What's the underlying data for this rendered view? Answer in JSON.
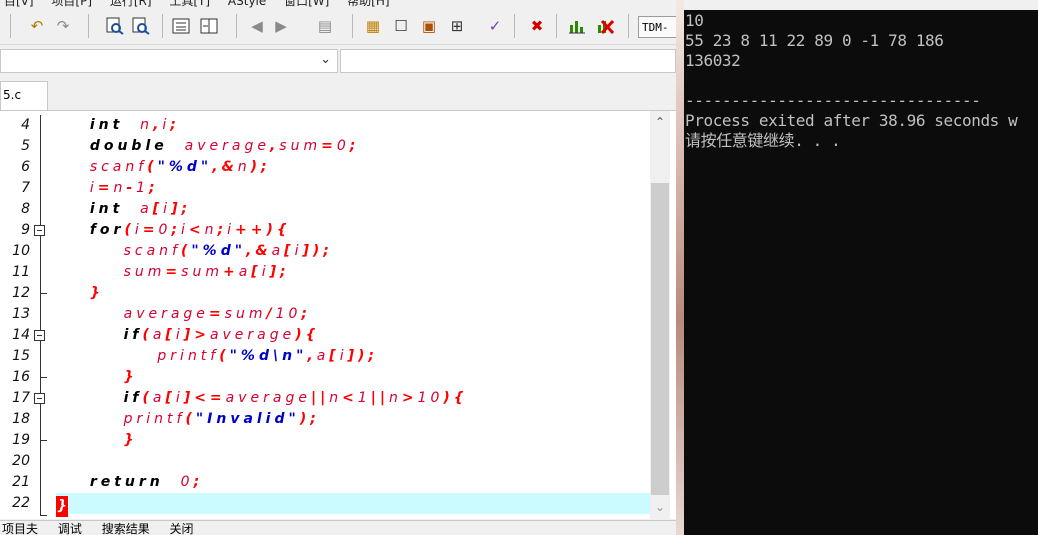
{
  "ide": {
    "menu": [
      "目[V]",
      "项目[P]",
      "运行[R]",
      "工具[T]",
      "AStyle",
      "窗口[W]",
      "帮助[H]"
    ],
    "toolbar": {
      "compiler_select": "TDM-"
    },
    "file_tab": "5.c",
    "line_numbers": [
      "4",
      "5",
      "6",
      "7",
      "8",
      "9",
      "10",
      "11",
      "12",
      "13",
      "14",
      "15",
      "16",
      "17",
      "18",
      "19",
      "20",
      "21",
      "22"
    ],
    "bottom_tabs": [
      "项目夫",
      "调试",
      "搜索结果",
      "关闭"
    ]
  },
  "console": {
    "lines": [
      "10",
      "55 23 8 11 22 89 0 -1 78 186",
      "136032",
      "",
      "--------------------------------",
      "Process exited after 38.96 seconds w",
      "请按任意键继续. . ."
    ]
  },
  "colors": {
    "keyword": "#000000",
    "identifier": "#d8002f",
    "string": "#0000cc",
    "current_line": "#ccfbff",
    "console_bg": "#0c0c0c",
    "console_fg": "#c0c0c0"
  }
}
